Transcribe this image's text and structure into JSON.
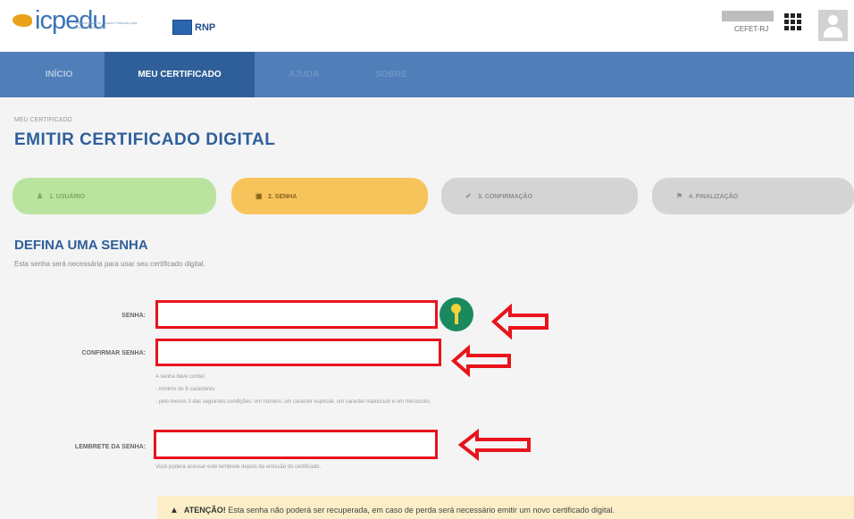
{
  "header": {
    "logo_text": "icpedu",
    "logo_subtitle": "Infraestrutura de Chaves Públicas para Ensino e Pesquisa",
    "partner_logo": "RNP",
    "organization": "CEFET-RJ",
    "apps_icon": "grid-icon",
    "avatar_icon": "user-icon"
  },
  "nav": {
    "items": [
      {
        "label": "INÍCIO"
      },
      {
        "label": "MEU CERTIFICADO"
      },
      {
        "label": "AJUDA"
      },
      {
        "label": "SOBRE"
      }
    ]
  },
  "page": {
    "breadcrumb": "MEU CERTIFICADO",
    "title": "EMITIR CERTIFICADO DIGITAL"
  },
  "steps": [
    {
      "label": "1. USUÁRIO",
      "icon": "user-icon",
      "status": "done"
    },
    {
      "label": "2. SENHA",
      "icon": "lock-icon",
      "status": "current"
    },
    {
      "label": "3. CONFIRMAÇÃO",
      "icon": "check-circle-icon",
      "status": "pending"
    },
    {
      "label": "4. FINALIZAÇÃO",
      "icon": "flag-icon",
      "status": "pending"
    }
  ],
  "form": {
    "section_title": "DEFINA UMA SENHA",
    "section_subtitle": "Esta senha será necessária para usar seu certificado digital.",
    "password_label": "SENHA:",
    "password_value": "",
    "confirm_label": "CONFIRMAR SENHA:",
    "confirm_value": "",
    "rules": [
      "A senha deve conter:",
      "- mínimo de 8 caracteres",
      "- pelo menos 3 das seguintes condições: um número, um caracter especial, um caracter maiúsculo e um minúsculo."
    ],
    "reminder_label": "LEMBRETE DA SENHA:",
    "reminder_value": "",
    "reminder_hint": "Você poderá acessar este lembrete depois da emissão do certificado."
  },
  "alert": {
    "strong": "ATENÇÃO!",
    "text": " Esta senha não poderá ser recuperada, em caso de perda será necessário emitir um novo certificado digital."
  },
  "colors": {
    "nav_bg": "#4f7eb8",
    "nav_active": "#2f5f98",
    "title": "#2e5f9b",
    "step_done": "#b9e49f",
    "step_current": "#f7c45c",
    "step_pending": "#d4d4d4",
    "annotation_red": "#e8131c"
  }
}
